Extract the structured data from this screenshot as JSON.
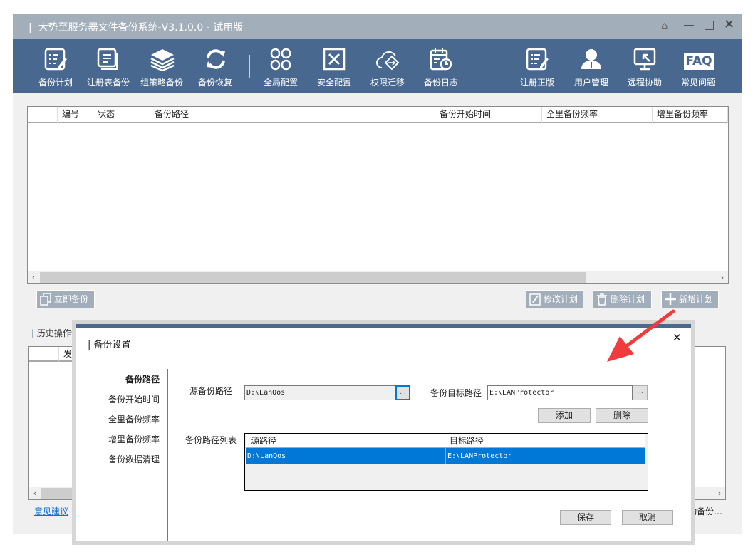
{
  "title_bar": {
    "title": "大势至服务器文件备份系统-V3.1.0.0 - 试用版",
    "controls": [
      "home-icon",
      "minimize-icon",
      "maximize-icon",
      "close-icon"
    ]
  },
  "toolbar": {
    "items": [
      {
        "label": "备份计划",
        "icon": "plan-edit-icon"
      },
      {
        "label": "注册表备份",
        "icon": "registry-icon"
      },
      {
        "label": "组策略备份",
        "icon": "layers-icon"
      },
      {
        "label": "备份恢复",
        "icon": "refresh-icon"
      },
      {
        "label": "全局配置",
        "icon": "grid-icon"
      },
      {
        "label": "安全配置",
        "icon": "tools-icon"
      },
      {
        "label": "权限迁移",
        "icon": "cloud-migrate-icon"
      },
      {
        "label": "备份日志",
        "icon": "calendar-clock-icon"
      },
      {
        "label": "注册正版",
        "icon": "register-icon"
      },
      {
        "label": "用户管理",
        "icon": "users-icon"
      },
      {
        "label": "远程协助",
        "icon": "monitor-icon"
      },
      {
        "label": "常见问题",
        "icon": "faq-icon",
        "icon_text": "FAQ"
      }
    ]
  },
  "plan_table": {
    "columns": [
      "",
      "编号",
      "状态",
      "备份路径",
      "备份开始时间",
      "全里备份频率",
      "增里备份频率"
    ],
    "rows": [],
    "scroll_position": 0
  },
  "actions": {
    "backup_now": "立即备份",
    "edit_plan": "修改计划",
    "delete_plan": "删除计划",
    "add_plan": "新增计划"
  },
  "history": {
    "label": "历史操作记",
    "columns": [
      "",
      "发生"
    ],
    "feedback_link": "意见建议",
    "right_text": "动备份…"
  },
  "dialog": {
    "title": "备份设置",
    "nav": [
      "备份路径",
      "备份开始时间",
      "全里备份频率",
      "增里备份频率",
      "备份数据清理"
    ],
    "active_nav": 0,
    "source_label": "源备份路径",
    "source_value": "D:\\LanQos",
    "target_label": "备份目标路径",
    "target_value": "E:\\LANProtector",
    "browse_label": "...",
    "add": "添加",
    "delete": "删除",
    "list_label": "备份路径列表",
    "list_columns": [
      "源路径",
      "目标路径"
    ],
    "list_rows": [
      {
        "source": "D:\\LanQos",
        "target": "E:\\LANProtector",
        "selected": true
      }
    ],
    "save": "保存",
    "cancel": "取消"
  },
  "colors": {
    "title_bar": "#a3aebb",
    "toolbar": "#48688f",
    "selection": "#0078d7",
    "annotation_arrow": "#f03c3c"
  }
}
